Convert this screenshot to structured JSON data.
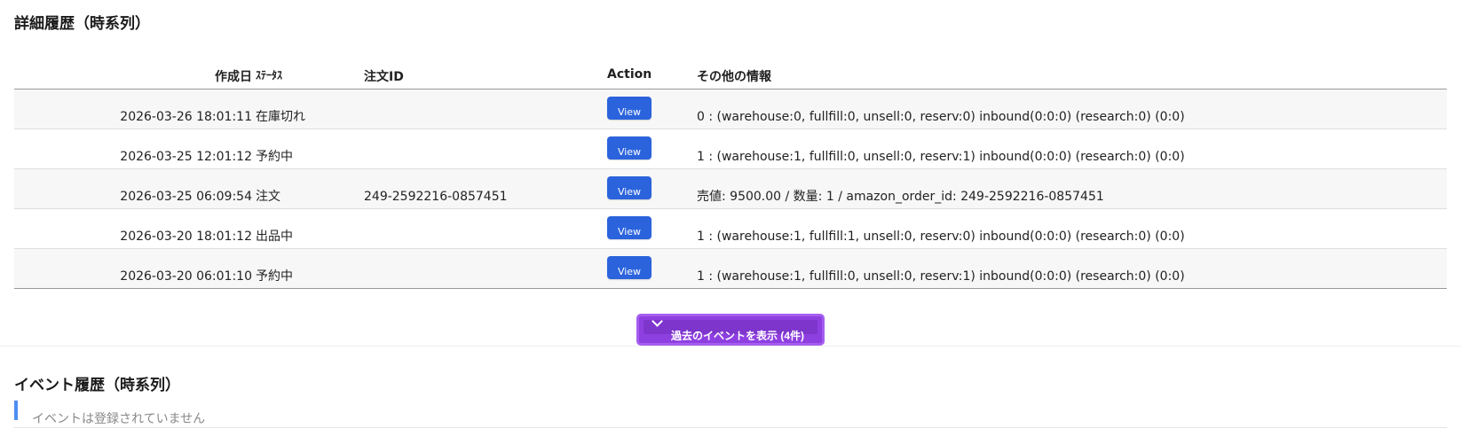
{
  "detail_section": {
    "title": "詳細履歴（時系列）"
  },
  "table": {
    "headers": {
      "date": "作成日",
      "status": "ｽﾃｰﾀｽ",
      "order_id": "注文ID",
      "action": "Action",
      "info": "その他の情報"
    },
    "rows": [
      {
        "date": "2026-03-26 18:01:11",
        "status": "在庫切れ",
        "order_id": "",
        "action_label": "View",
        "info": "0 : (warehouse:0, fullfill:0, unsell:0, reserv:0) inbound(0:0:0) (research:0) (0:0)"
      },
      {
        "date": "2026-03-25 12:01:12",
        "status": "予約中",
        "order_id": "",
        "action_label": "View",
        "info": "1 : (warehouse:1, fullfill:0, unsell:0, reserv:1) inbound(0:0:0) (research:0) (0:0)"
      },
      {
        "date": "2026-03-25 06:09:54",
        "status": "注文",
        "order_id": "249-2592216-0857451",
        "action_label": "View",
        "info": "売値: 9500.00 / 数量: 1 / amazon_order_id: 249-2592216-0857451"
      },
      {
        "date": "2026-03-20 18:01:12",
        "status": "出品中",
        "order_id": "",
        "action_label": "View",
        "info": "1 : (warehouse:1, fullfill:1, unsell:0, reserv:0) inbound(0:0:0) (research:0) (0:0)"
      },
      {
        "date": "2026-03-20 06:01:10",
        "status": "予約中",
        "order_id": "",
        "action_label": "View",
        "info": "1 : (warehouse:1, fullfill:0, unsell:0, reserv:1) inbound(0:0:0) (research:0) (0:0)"
      }
    ]
  },
  "show_more": {
    "label": "過去のイベントを表示 (4件)",
    "icon": "chevron-down-icon",
    "color": "#8e3fe0"
  },
  "event_section": {
    "title": "イベント履歴（時系列）",
    "empty_text": "イベントは登録されていません"
  },
  "colors": {
    "view_button": "#2b63dd",
    "accent_bar": "#4d8ef0"
  }
}
